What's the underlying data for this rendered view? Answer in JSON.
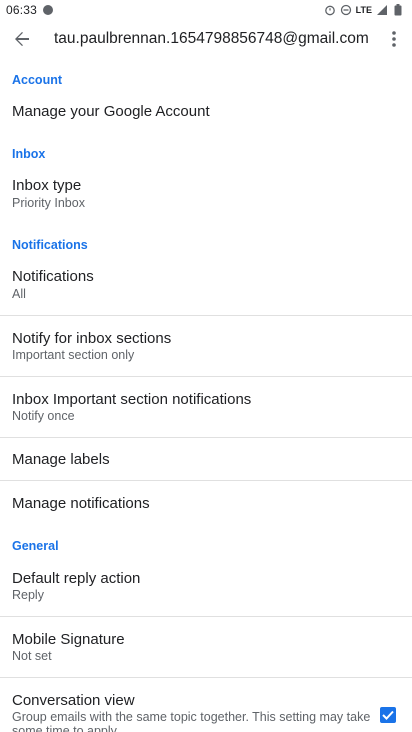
{
  "status_bar": {
    "time": "06:33",
    "network": "LTE"
  },
  "app_bar": {
    "title": "tau.paulbrennan.1654798856748@gmail.com"
  },
  "sections": {
    "account": "Account",
    "inbox": "Inbox",
    "notifications": "Notifications",
    "general": "General"
  },
  "items": {
    "manage_google_account": {
      "title": "Manage your Google Account"
    },
    "inbox_type": {
      "title": "Inbox type",
      "subtitle": "Priority Inbox"
    },
    "notifications": {
      "title": "Notifications",
      "subtitle": "All"
    },
    "notify_inbox_sections": {
      "title": "Notify for inbox sections",
      "subtitle": "Important section only"
    },
    "inbox_important_notifications": {
      "title": "Inbox Important section notifications",
      "subtitle": "Notify once"
    },
    "manage_labels": {
      "title": "Manage labels"
    },
    "manage_notifications": {
      "title": "Manage notifications"
    },
    "default_reply_action": {
      "title": "Default reply action",
      "subtitle": "Reply"
    },
    "mobile_signature": {
      "title": "Mobile Signature",
      "subtitle": "Not set"
    },
    "conversation_view": {
      "title": "Conversation view",
      "subtitle": "Group emails with the same topic together. This setting may take some time to apply.",
      "checked": true
    }
  },
  "colors": {
    "accent": "#1a73e8",
    "secondary_text": "#5f6368",
    "divider": "#e0e0e0"
  }
}
